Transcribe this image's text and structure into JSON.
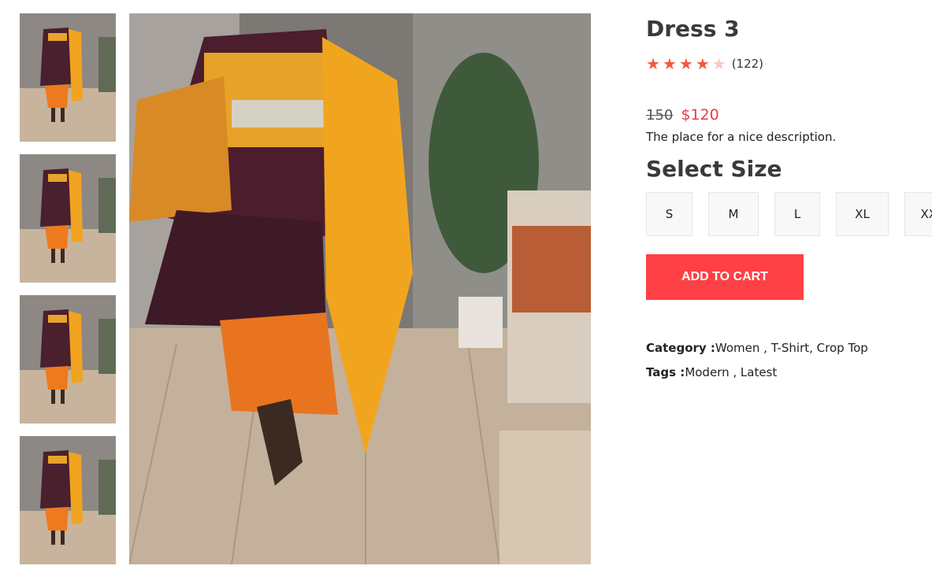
{
  "product": {
    "title": "Dress 3",
    "rating": {
      "value": 4,
      "max": 5,
      "count_text": "(122)"
    },
    "price": {
      "old": "150",
      "current": "$120"
    },
    "description": "The place for a nice description.",
    "size_heading": "Select Size",
    "sizes": [
      "S",
      "M",
      "L",
      "XL",
      "XXL"
    ],
    "add_to_cart_label": "ADD TO CART",
    "category": {
      "label": "Category :",
      "value": "Women , T-Shirt, Crop Top"
    },
    "tags": {
      "label": "Tags :",
      "value": "Modern , Latest"
    }
  },
  "colors": {
    "accent": "#ff4044",
    "price": "#f03a47",
    "star": "#f05a3c",
    "star_empty": "#f7c9c0"
  }
}
